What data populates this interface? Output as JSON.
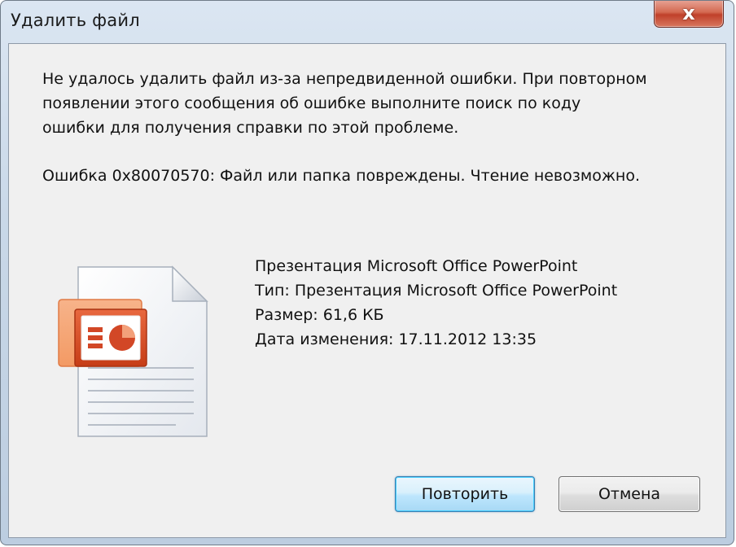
{
  "window": {
    "title": "Удалить файл",
    "close_glyph": "x"
  },
  "message": {
    "lines": [
      "Не удалось удалить файл из-за непредвиденной ошибки. При повторном",
      "появлении этого сообщения об ошибке выполните поиск по коду",
      "ошибки для получения справки по этой проблеме."
    ],
    "error": "Ошибка 0x80070570: Файл или папка повреждены. Чтение невозможно."
  },
  "file": {
    "icon": "powerpoint-file-icon",
    "name": "Презентация Microsoft Office PowerPoint",
    "type": "Тип: Презентация Microsoft Office PowerPoint",
    "size": "Размер: 61,6 КБ",
    "modified": "Дата изменения: 17.11.2012 13:35"
  },
  "buttons": {
    "retry": "Повторить",
    "cancel": "Отмена"
  },
  "colors": {
    "close_red": "#c0402a",
    "accent_blue": "#3c7fb1",
    "powerpoint_orange": "#d24726"
  }
}
